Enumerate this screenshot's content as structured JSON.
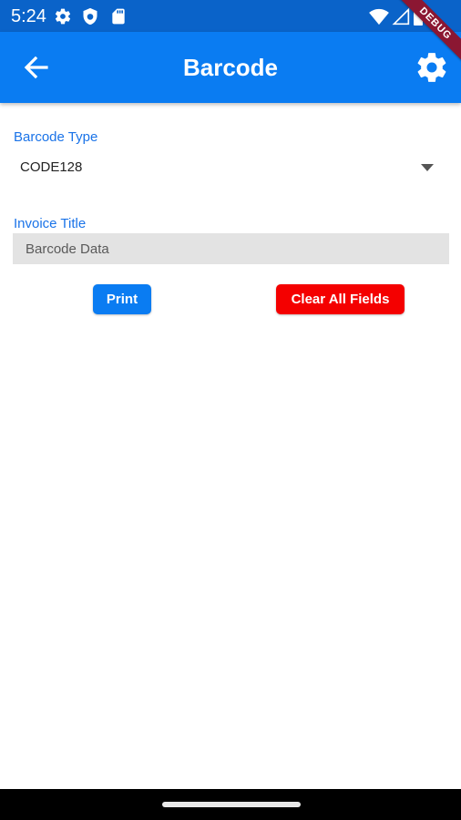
{
  "status_bar": {
    "time": "5:24",
    "icons": [
      "settings-icon",
      "shield-icon",
      "sd-card-icon",
      "wifi-icon",
      "signal-icon",
      "battery-icon"
    ]
  },
  "debug_banner": "DEBUG",
  "app_bar": {
    "title": "Barcode",
    "back_icon": "arrow-back-icon",
    "settings_icon": "gear-icon"
  },
  "form": {
    "barcode_type_label": "Barcode Type",
    "barcode_type_value": "CODE128",
    "invoice_title_label": "Invoice Title",
    "barcode_data_placeholder": "Barcode Data",
    "barcode_data_value": ""
  },
  "buttons": {
    "print_label": "Print",
    "clear_label": "Clear All Fields"
  },
  "colors": {
    "status_bar": "#0a63c9",
    "app_bar": "#0a7cf2",
    "label": "#1a73e8",
    "print_button": "#0a7cf2",
    "clear_button": "#f40000",
    "debug_banner": "#8b1732"
  }
}
